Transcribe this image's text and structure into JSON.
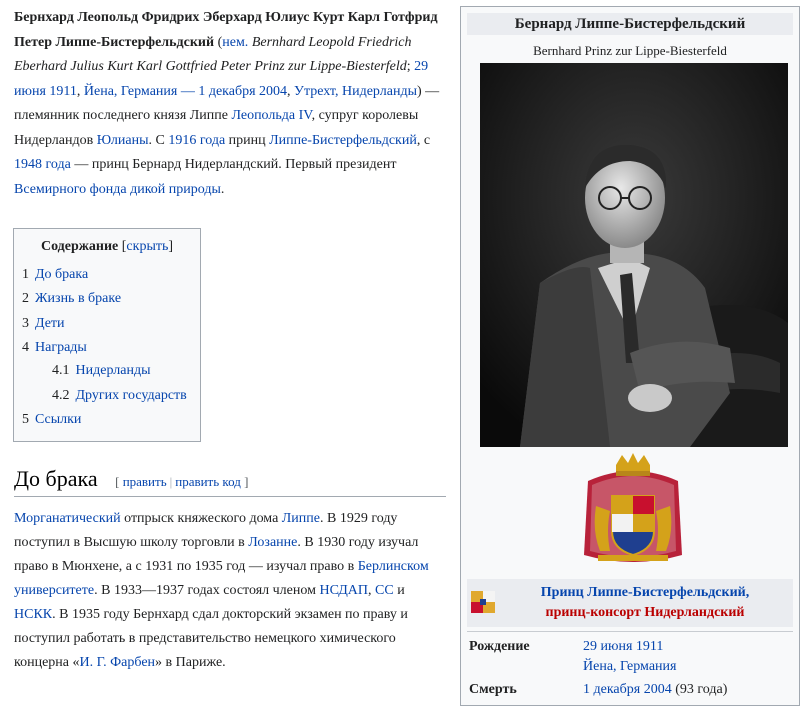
{
  "lead": {
    "name_bold": "Бернхард Леопольд Фридрих Эберхард Юлиус Курт Карл Готфрид Петер Липпе-Бистерфельдский",
    "lang_link": "нем.",
    "german_name": "Bernhard Leopold Friedrich Eberhard Julius Kurt Karl Gottfried Peter Prinz zur Lippe-Biesterfeld",
    "birth_date": "29 июня 1911",
    "birth_place": "Йена, Германия",
    "dash": "—",
    "death_date": "1 декабря 2004",
    "death_place": "Утрехт, Нидерланды",
    "text1": "— племянник последнего князя Липпе",
    "leopold": "Леопольда IV",
    "text2": ", супруг королевы Нидерландов",
    "juliana": "Юлианы",
    "text3": ". С",
    "year1916": "1916 года",
    "text4": "принц",
    "lippe_title": "Липпе-Бистерфельдский",
    "text5": ", с",
    "year1948": "1948 года",
    "text6": "— принц Бернард Нидерландский. Первый президент",
    "wwf": "Всемирного фонда дикой природы",
    "text7": "."
  },
  "toc": {
    "title": "Содержание",
    "hide": "скрыть",
    "items": [
      {
        "num": "1",
        "label": "До брака"
      },
      {
        "num": "2",
        "label": "Жизнь в браке"
      },
      {
        "num": "3",
        "label": "Дети"
      },
      {
        "num": "4",
        "label": "Награды"
      },
      {
        "num": "4.1",
        "label": "Нидерланды"
      },
      {
        "num": "4.2",
        "label": "Других государств"
      },
      {
        "num": "5",
        "label": "Ссылки"
      }
    ]
  },
  "section": {
    "title": "До брака",
    "edit": "править",
    "edit_code": "править код",
    "morg": "Морганатический",
    "t1": "отпрыск княжеского дома",
    "lippe": "Липпе",
    "t2": ". В 1929 году поступил в Высшую школу торговли в",
    "lausanne": "Лозанне",
    "t3": ". В 1930 году изучал право в Мюнхене, а с 1931 по 1935 год — изучал право в",
    "berlin_uni": "Берлинском университете",
    "t4": ". В 1933—1937 годах состоял членом",
    "nsdap": "НСДАП",
    "sep1": ",",
    "ss": "СС",
    "and": "и",
    "nskk": "НСКК",
    "t5": ". В 1935 году Бернхард сдал докторский экзамен по праву и поступил работать в представительство немецкого химического концерна «",
    "igfarben": "И. Г. Фарбен",
    "t6": "» в Париже."
  },
  "infobox": {
    "title": "Бернард Липпе-Бистерфельдский",
    "subtitle": "Bernhard Prinz zur Lippe-Biesterfeld",
    "caption_line1": "Принц Липпе-Бистерфельдский,",
    "caption_line2": "принц-консорт Нидерландский",
    "birth_label": "Рождение",
    "birth_date": "29 июня 1911",
    "birth_place": "Йена, Германия",
    "death_label": "Смерть",
    "death_date": "1 декабря 2004",
    "death_age": "(93 года)"
  },
  "colors": {
    "link": "#0645ad",
    "redlink": "#ba0000",
    "infobox_bg": "#f8f9fa",
    "header_bg": "#eaecf0"
  }
}
